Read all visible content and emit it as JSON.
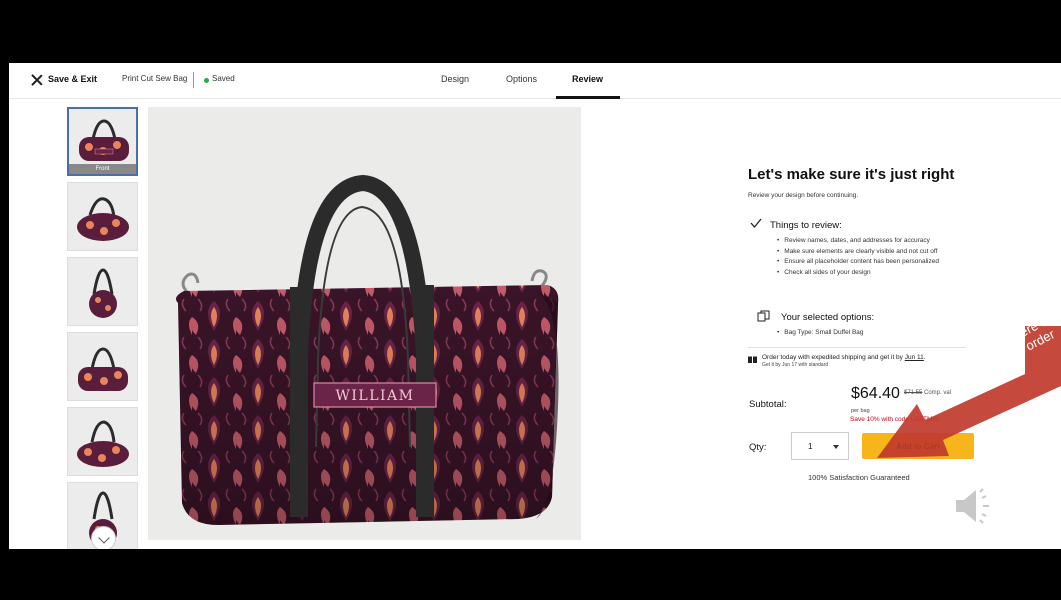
{
  "header": {
    "close_label": "Save & Exit",
    "product_name": "Print Cut Sew Bag",
    "save_status": "Saved",
    "tabs": [
      {
        "label": "Design"
      },
      {
        "label": "Options"
      },
      {
        "label": "Review"
      }
    ],
    "active_tab": "Review",
    "status_color": "#2aa84a"
  },
  "thumbnails": {
    "items": [
      {
        "label": "Front",
        "view": "front",
        "active": true
      },
      {
        "label": "",
        "view": "angle-left"
      },
      {
        "label": "",
        "view": "end"
      },
      {
        "label": "",
        "view": "front-flat"
      },
      {
        "label": "",
        "view": "angle-right"
      },
      {
        "label": "",
        "view": "end-top"
      }
    ],
    "scroll_icon": "chevron-down-icon"
  },
  "preview": {
    "personalization_text": "WILLIAM",
    "pattern_colors": [
      "#3a1428",
      "#6b2448",
      "#e8855a",
      "#c45a6a"
    ],
    "strap_color": "#2b2b2b"
  },
  "review": {
    "title": "Let's make sure it's just right",
    "subtitle": "Review your design before continuing.",
    "things_title": "Things to review:",
    "things": [
      "Review names, dates, and addresses for accuracy",
      "Make sure elements are clearly visible and not cut off",
      "Ensure all placeholder content has been personalized",
      "Check all sides of your design"
    ],
    "options_title": "Your selected options:",
    "options": [
      "Bag Type: Small Duffel Bag"
    ],
    "shipping_line": "Order today with expedited shipping and get it by ",
    "shipping_date": "Jun 11",
    "shipping_sub": "Get it by Jun 17 with standard",
    "subtotal_label": "Subtotal:",
    "price": "$64.40",
    "comp_price": "$71.55",
    "comp_label": "Comp. val",
    "per_unit": "per bag",
    "promo": "Save 10% with code LASTMIN",
    "qty_label": "Qty:",
    "qty_value": "1",
    "add_to_cart": "Add to Cart",
    "guarantee": "100% Satisfaction Guaranteed",
    "accent_color": "#f6b51b",
    "promo_color": "#d0021b"
  },
  "annotation": {
    "line1": "Click here to",
    "line2": "place order",
    "color": "#c0392b"
  },
  "speaker_icon": "speaker-icon"
}
